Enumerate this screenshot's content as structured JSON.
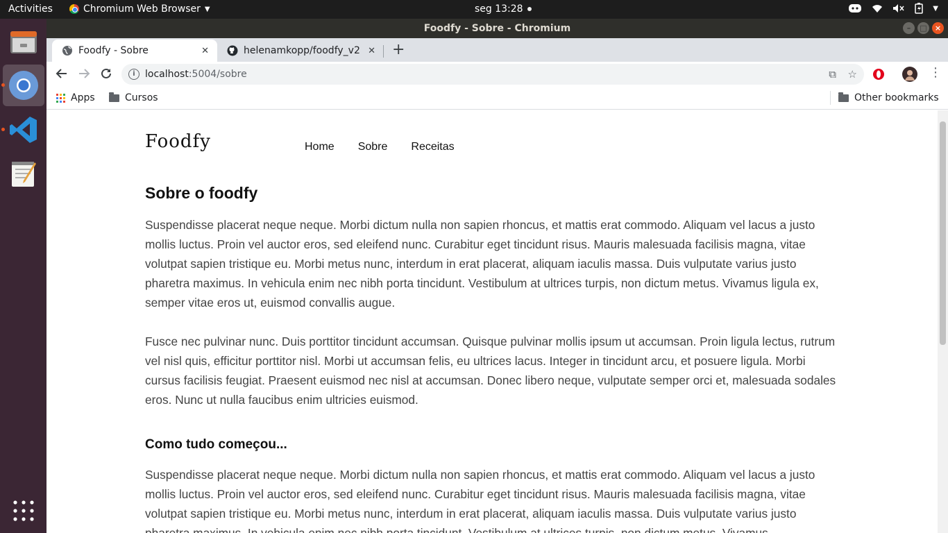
{
  "topbar": {
    "activities": "Activities",
    "app_name": "Chromium Web Browser",
    "clock": "seg 13:28"
  },
  "dock": {
    "items": [
      "files-icon",
      "chromium-icon",
      "vscode-icon",
      "text-editor-icon"
    ],
    "show_apps": "show-applications-icon"
  },
  "window": {
    "title": "Foodfy - Sobre - Chromium"
  },
  "tabs": [
    {
      "title": "Foodfy - Sobre",
      "active": true
    },
    {
      "title": "helenamkopp/foodfy_v2",
      "active": false
    }
  ],
  "toolbar": {
    "url_host": "localhost",
    "url_path": ":5004/sobre"
  },
  "bookmarks": {
    "apps": "Apps",
    "cursos": "Cursos",
    "other": "Other bookmarks"
  },
  "site": {
    "logo": "Foodfy",
    "nav": [
      "Home",
      "Sobre",
      "Receitas"
    ]
  },
  "content": {
    "title": "Sobre o foodfy",
    "paragraph1": "Suspendisse placerat neque neque. Morbi dictum nulla non sapien rhoncus, et mattis erat commodo. Aliquam vel lacus a justo mollis luctus. Proin vel auctor eros, sed eleifend nunc. Curabitur eget tincidunt risus. Mauris malesuada facilisis magna, vitae volutpat sapien tristique eu. Morbi metus nunc, interdum in erat placerat, aliquam iaculis massa. Duis vulputate varius justo pharetra maximus. In vehicula enim nec nibh porta tincidunt. Vestibulum at ultrices turpis, non dictum metus. Vivamus ligula ex, semper vitae eros ut, euismod convallis augue.",
    "paragraph2": "Fusce nec pulvinar nunc. Duis porttitor tincidunt accumsan. Quisque pulvinar mollis ipsum ut accumsan. Proin ligula lectus, rutrum vel nisl quis, efficitur porttitor nisl. Morbi ut accumsan felis, eu ultrices lacus. Integer in tincidunt arcu, et posuere ligula. Morbi cursus facilisis feugiat. Praesent euismod nec nisl at accumsan. Donec libero neque, vulputate semper orci et, malesuada sodales eros. Nunc ut nulla faucibus enim ultricies euismod.",
    "subtitle": "Como tudo começou...",
    "paragraph3": "Suspendisse placerat neque neque. Morbi dictum nulla non sapien rhoncus, et mattis erat commodo. Aliquam vel lacus a justo mollis luctus. Proin vel auctor eros, sed eleifend nunc. Curabitur eget tincidunt risus. Mauris malesuada facilisis magna, vitae volutpat sapien tristique eu. Morbi metus nunc, interdum in erat placerat, aliquam iaculis massa. Duis vulputate varius justo pharetra maximus. In vehicula enim nec nibh porta tincidunt. Vestibulum at ultrices turpis, non dictum metus. Vivamus"
  },
  "colors": {
    "ubuntu_orange": "#e95420",
    "dock_bg": "#3b2634",
    "topbar_bg": "#1d1d1d",
    "tabstrip_bg": "#dee1e6"
  }
}
